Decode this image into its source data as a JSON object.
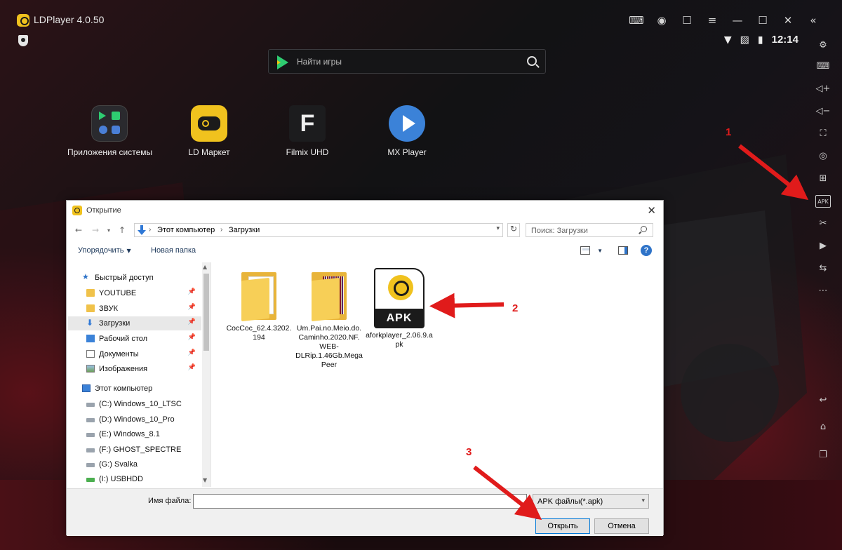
{
  "app": {
    "title": "LDPlayer 4.0.50",
    "search_placeholder": "Найти игры",
    "time": "12:14",
    "tiles": [
      {
        "label": "Приложения системы"
      },
      {
        "label": "LD Маркет"
      },
      {
        "label": "Filmix UHD",
        "letter": "F"
      },
      {
        "label": "MX Player"
      }
    ],
    "apk_tool_label": "APK",
    "titlebar_icons": [
      "gamepad-icon",
      "account-icon",
      "bookmark-icon",
      "menu-icon",
      "minimize-icon",
      "maximize-icon",
      "close-icon",
      "collapse-icon"
    ],
    "side_icons": [
      "settings-icon",
      "keyboard-icon",
      "volume-up-icon",
      "volume-down-icon",
      "fullscreen-icon",
      "record-icon",
      "add-window-icon",
      "apk-install-icon",
      "scissors-icon",
      "video-icon",
      "sync-icon",
      "more-icon",
      "back-icon",
      "home-icon",
      "recent-apps-icon"
    ]
  },
  "dialog": {
    "title": "Открытие",
    "breadcrumbs": [
      "Этот компьютер",
      "Загрузки"
    ],
    "search_placeholder": "Поиск: Загрузки",
    "organize_label": "Упорядочить",
    "new_folder_label": "Новая папка",
    "help_label": "?",
    "nav": {
      "quick_access": "Быстрый доступ",
      "quick_items": [
        {
          "label": "YOUTUBE",
          "icon": "folder-icon"
        },
        {
          "label": "ЗВУК",
          "icon": "folder-icon"
        },
        {
          "label": "Загрузки",
          "icon": "downloads-icon"
        },
        {
          "label": "Рабочий стол",
          "icon": "desktop-icon"
        },
        {
          "label": "Документы",
          "icon": "documents-icon"
        },
        {
          "label": "Изображения",
          "icon": "pictures-icon"
        }
      ],
      "this_pc": "Этот компьютер",
      "drives": [
        "(C:) Windows_10_LTSC",
        "(D:) Windows_10_Pro",
        "(E:) Windows_8.1",
        "(F:) GHOST_SPECTRE",
        "(G:) Svalka",
        "(I:) USBHDD"
      ]
    },
    "files": [
      {
        "name": "CocCoc_62.4.3202.194",
        "type": "folder"
      },
      {
        "name": "Um.Pai.no.Meio.do.Caminho.2020.NF.WEB-DLRip.1.46Gb.MegaPeer",
        "type": "folder"
      },
      {
        "name": "aforkplayer_2.06.9.apk",
        "type": "apk",
        "badge": "APK"
      }
    ],
    "filename_label": "Имя файла:",
    "filename_value": "",
    "filetype_value": "APK файлы(*.apk)",
    "open_label": "Открыть",
    "cancel_label": "Отмена"
  },
  "annotations": [
    "1",
    "2",
    "3"
  ],
  "colors": {
    "accent": "#f0c21e",
    "arrow": "#e01b1b",
    "link": "#0078d7"
  }
}
